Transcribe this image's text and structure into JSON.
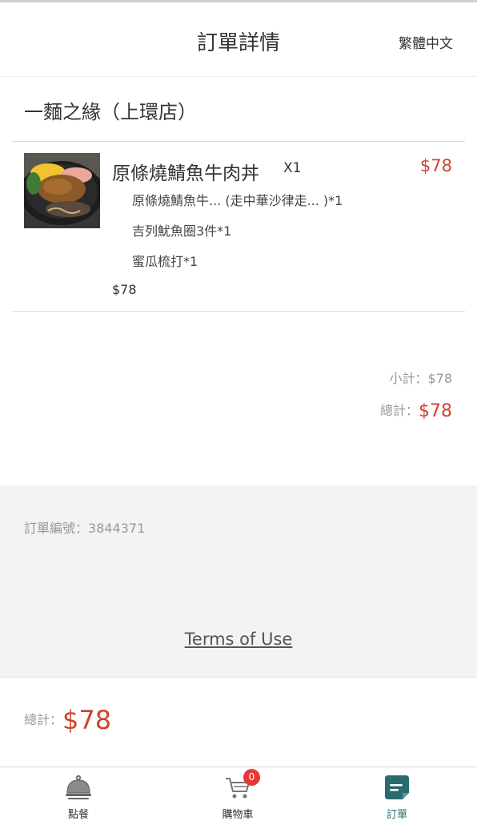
{
  "header": {
    "title": "訂單詳情",
    "language": "繁體中文"
  },
  "shop": {
    "name": "一麵之緣（上環店）"
  },
  "order_item": {
    "name": "原條燒鯖魚牛肉丼",
    "qty": "X1",
    "price": "$78",
    "options": [
      "原條燒鯖魚牛... (走中華沙律走... )*1",
      "吉列魷魚圈3件*1",
      "蜜瓜梳打*1"
    ],
    "subtotal": "$78"
  },
  "summary": {
    "subtotal_label": "小計：",
    "subtotal_value": "$78",
    "total_label": "總計：",
    "total_value": "$78"
  },
  "info": {
    "order_number_label": "訂單編號：",
    "order_number": "3844371",
    "terms_link": "Terms of Use"
  },
  "footer_total": {
    "label": "總計：",
    "value": "$78"
  },
  "tabbar": {
    "tabs": [
      {
        "label": "點餐",
        "icon": "cloche-icon"
      },
      {
        "label": "購物車",
        "icon": "cart-icon",
        "badge": "0"
      },
      {
        "label": "訂單",
        "icon": "order-list-icon"
      }
    ]
  },
  "colors": {
    "accent": "#d0432b",
    "active_tab": "#2a6b6e",
    "badge": "#e53935"
  }
}
